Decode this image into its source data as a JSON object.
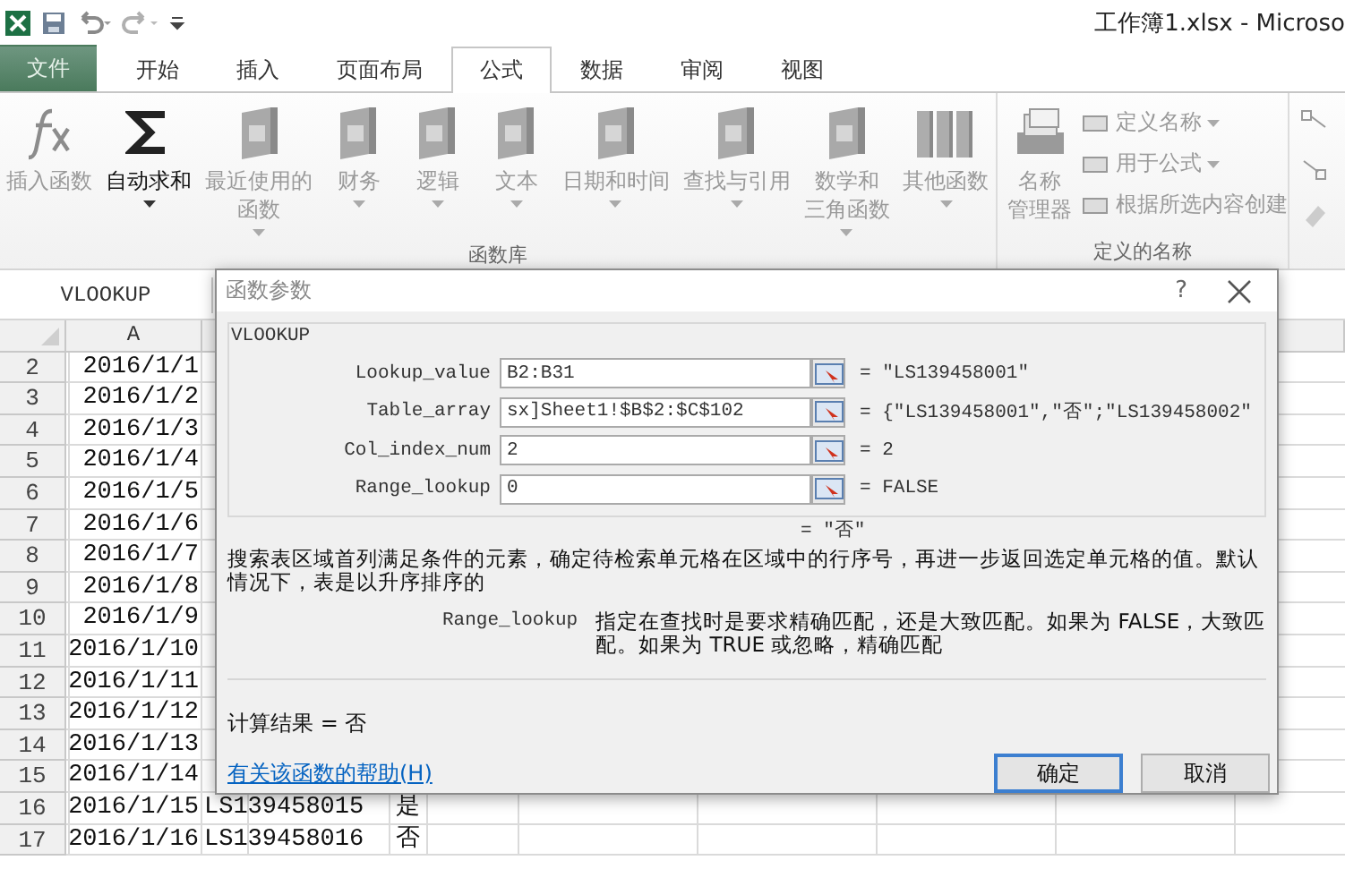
{
  "title_bar": {
    "title": "工作簿1.xlsx  -  Microso"
  },
  "tabs": [
    {
      "label": "文件",
      "kind": "file",
      "selected": false
    },
    {
      "label": "开始",
      "kind": "tab",
      "selected": false
    },
    {
      "label": "插入",
      "kind": "tab",
      "selected": false
    },
    {
      "label": "页面布局",
      "kind": "tab",
      "selected": false
    },
    {
      "label": "公式",
      "kind": "tab",
      "selected": true
    },
    {
      "label": "数据",
      "kind": "tab",
      "selected": false
    },
    {
      "label": "审阅",
      "kind": "tab",
      "selected": false
    },
    {
      "label": "视图",
      "kind": "tab",
      "selected": false
    }
  ],
  "ribbon": {
    "function_library": {
      "label": "函数库",
      "buttons": [
        {
          "lines": [
            "插入函数"
          ],
          "kind": "fx",
          "disabled": true,
          "dropdown": false
        },
        {
          "lines": [
            "自动求和"
          ],
          "kind": "sigma",
          "disabled": false,
          "dropdown": true
        },
        {
          "lines": [
            "最近使用的",
            "函数"
          ],
          "kind": "book",
          "disabled": true,
          "dropdown": true
        },
        {
          "lines": [
            "财务"
          ],
          "kind": "book",
          "disabled": true,
          "dropdown": true
        },
        {
          "lines": [
            "逻辑"
          ],
          "kind": "book",
          "disabled": true,
          "dropdown": true
        },
        {
          "lines": [
            "文本"
          ],
          "kind": "book",
          "disabled": true,
          "dropdown": true
        },
        {
          "lines": [
            "日期和时间"
          ],
          "kind": "book",
          "disabled": true,
          "dropdown": true
        },
        {
          "lines": [
            "查找与引用"
          ],
          "kind": "book",
          "disabled": true,
          "dropdown": true
        },
        {
          "lines": [
            "数学和",
            "三角函数"
          ],
          "kind": "book",
          "disabled": true,
          "dropdown": true
        },
        {
          "lines": [
            "其他函数"
          ],
          "kind": "books",
          "disabled": true,
          "dropdown": true
        }
      ]
    },
    "defined_names": {
      "label": "定义的名称",
      "manager": {
        "lines": [
          "名称",
          "管理器"
        ],
        "disabled": true
      },
      "items": [
        {
          "label": "定义名称",
          "dropdown": true,
          "disabled": true
        },
        {
          "label": "用于公式",
          "dropdown": true,
          "disabled": true
        },
        {
          "label": "根据所选内容创建",
          "dropdown": false,
          "disabled": true
        }
      ]
    }
  },
  "formula_bar": {
    "name_box": "VLOOKUP"
  },
  "sheet": {
    "columns": [
      "A"
    ],
    "rows": [
      {
        "number": "2",
        "a": "2016/1/1"
      },
      {
        "number": "3",
        "a": "2016/1/2"
      },
      {
        "number": "4",
        "a": "2016/1/3"
      },
      {
        "number": "5",
        "a": "2016/1/4"
      },
      {
        "number": "6",
        "a": "2016/1/5"
      },
      {
        "number": "7",
        "a": "2016/1/6"
      },
      {
        "number": "8",
        "a": "2016/1/7"
      },
      {
        "number": "9",
        "a": "2016/1/8"
      },
      {
        "number": "10",
        "a": "2016/1/9"
      },
      {
        "number": "11",
        "a": "2016/1/10"
      },
      {
        "number": "12",
        "a": "2016/1/11"
      },
      {
        "number": "13",
        "a": "2016/1/12"
      },
      {
        "number": "14",
        "a": "2016/1/13"
      },
      {
        "number": "15",
        "a": "2016/1/14"
      },
      {
        "number": "16",
        "a": "2016/1/15",
        "b": "LS139458015",
        "c": "是"
      },
      {
        "number": "17",
        "a": "2016/1/16",
        "b": "LS139458016",
        "c": "否"
      }
    ]
  },
  "dialog": {
    "title": "函数参数",
    "help_glyph": "?",
    "function_name": "VLOOKUP",
    "arguments": [
      {
        "label": "Lookup_value",
        "value": "B2:B31",
        "result": "= \"LS139458001\""
      },
      {
        "label": "Table_array",
        "value": "sx]Sheet1!$B$2:$C$102",
        "result": "= {\"LS139458001\",\"否\";\"LS139458002\""
      },
      {
        "label": "Col_index_num",
        "value": "2",
        "result": "= 2"
      },
      {
        "label": "Range_lookup",
        "value": "0",
        "result": "= FALSE"
      }
    ],
    "formula_result": "= \"否\"",
    "description": "搜索表区域首列满足条件的元素，确定待检索单元格在区域中的行序号，再进一步返回选定单元格的值。默认情况下，表是以升序排序的",
    "parameter_help": {
      "name": "Range_lookup",
      "text": "指定在查找时是要求精确匹配，还是大致匹配。如果为 FALSE，大致匹配。如果为 TRUE 或忽略，精确匹配"
    },
    "calculation_result": "计算结果 =  否",
    "help_link": "有关该函数的帮助(H)",
    "buttons": [
      {
        "label": "确定",
        "default": true
      },
      {
        "label": "取消",
        "default": false
      }
    ]
  }
}
